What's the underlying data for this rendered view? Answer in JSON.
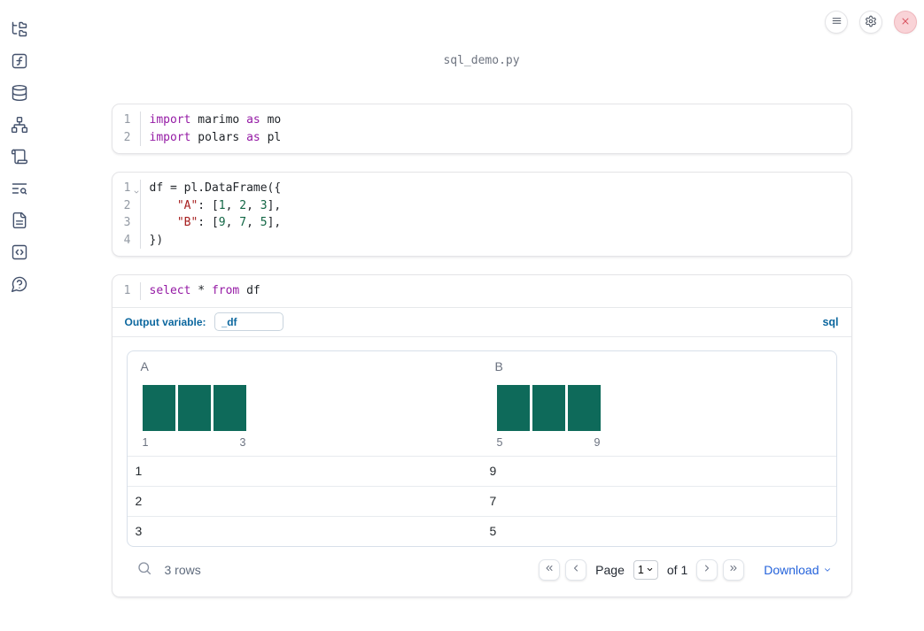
{
  "window": {
    "title": "sql_demo.py"
  },
  "topbar": {
    "buttons": [
      {
        "id": "menu",
        "icon": "hamburger-menu-icon"
      },
      {
        "id": "settings",
        "icon": "gear-icon"
      },
      {
        "id": "shutdown",
        "icon": "close-icon"
      }
    ]
  },
  "sidebar": {
    "items": [
      {
        "id": "file-explorer",
        "icon": "folder-tree-icon"
      },
      {
        "id": "variables",
        "icon": "function-square-icon"
      },
      {
        "id": "data-sources",
        "icon": "database-icon"
      },
      {
        "id": "dependencies",
        "icon": "network-icon"
      },
      {
        "id": "logs",
        "icon": "scroll-icon"
      },
      {
        "id": "outline-search",
        "icon": "list-search-icon"
      },
      {
        "id": "documentation",
        "icon": "file-text-icon"
      },
      {
        "id": "snippets",
        "icon": "code-box-icon"
      },
      {
        "id": "help",
        "icon": "help-bubble-icon"
      }
    ]
  },
  "cells": [
    {
      "id": "imports",
      "lines": [
        {
          "n": "1",
          "tokens": [
            [
              "kw",
              "import"
            ],
            [
              "t",
              " marimo "
            ],
            [
              "kw",
              "as"
            ],
            [
              "t",
              " mo"
            ]
          ]
        },
        {
          "n": "2",
          "tokens": [
            [
              "kw",
              "import"
            ],
            [
              "t",
              " polars "
            ],
            [
              "kw",
              "as"
            ],
            [
              "t",
              " pl"
            ]
          ]
        }
      ]
    },
    {
      "id": "dataframe",
      "lines": [
        {
          "n": "1",
          "fold": true,
          "tokens": [
            [
              "t",
              "df = pl.DataFrame({"
            ]
          ]
        },
        {
          "n": "2",
          "tokens": [
            [
              "t",
              "    "
            ],
            [
              "str",
              "\"A\""
            ],
            [
              "t",
              ": ["
            ],
            [
              "num",
              "1"
            ],
            [
              "t",
              ", "
            ],
            [
              "num",
              "2"
            ],
            [
              "t",
              ", "
            ],
            [
              "num",
              "3"
            ],
            [
              "t",
              "],"
            ]
          ]
        },
        {
          "n": "3",
          "tokens": [
            [
              "t",
              "    "
            ],
            [
              "str",
              "\"B\""
            ],
            [
              "t",
              ": ["
            ],
            [
              "num",
              "9"
            ],
            [
              "t",
              ", "
            ],
            [
              "num",
              "7"
            ],
            [
              "t",
              ", "
            ],
            [
              "num",
              "5"
            ],
            [
              "t",
              "],"
            ]
          ]
        },
        {
          "n": "4",
          "tokens": [
            [
              "t",
              "})"
            ]
          ]
        }
      ]
    },
    {
      "id": "sql",
      "lines": [
        {
          "n": "1",
          "tokens": [
            [
              "kw",
              "select"
            ],
            [
              "t",
              " * "
            ],
            [
              "kw",
              "from"
            ],
            [
              "t",
              " df"
            ]
          ]
        }
      ]
    }
  ],
  "sql_cell": {
    "output_variable_label": "Output variable:",
    "output_variable_value": "_df",
    "language_badge": "sql"
  },
  "table": {
    "columns": [
      {
        "name": "A",
        "hist": {
          "bars": 3,
          "min_label": "1",
          "max_label": "3"
        }
      },
      {
        "name": "B",
        "hist": {
          "bars": 3,
          "min_label": "5",
          "max_label": "9"
        }
      }
    ],
    "rows": [
      [
        "1",
        "9"
      ],
      [
        "2",
        "7"
      ],
      [
        "3",
        "5"
      ]
    ],
    "footer": {
      "row_count": "3 rows",
      "page_label": "Page",
      "page_value": "1",
      "of_label": "of 1",
      "download_label": "Download"
    }
  },
  "colors": {
    "histogram_bar": "#0e6a5a",
    "sql_accent_blue": "#0d689f",
    "download_blue": "#2563db",
    "keyword_purple": "#951ba5",
    "string_red": "#a61f1f",
    "number_green": "#116644",
    "close_button_bg": "#f9d3d7",
    "close_button_x": "#d8515e"
  }
}
